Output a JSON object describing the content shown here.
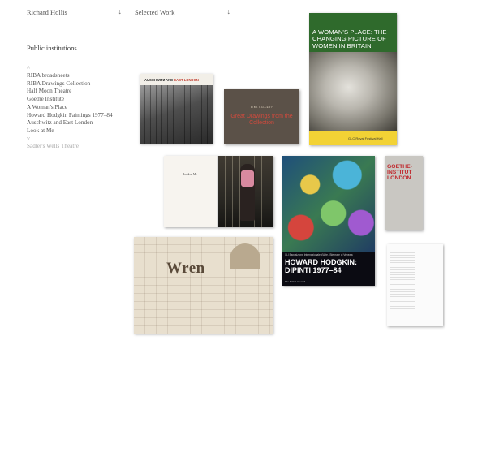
{
  "header": {
    "author_select": {
      "label": "Richard Hollis",
      "arrow": "↓"
    },
    "section_select": {
      "label": "Selected Work",
      "arrow": "↓"
    }
  },
  "category": {
    "title": "Public institutions",
    "up_arrow": "˄",
    "down_arrow": "˅",
    "items": [
      "RIBA broadsheets",
      "RIBA Drawings Collection",
      "Half Moon Theatre",
      "Goethe Institute",
      "A Woman's Place",
      "Howard Hodgkin Paintings 1977–84",
      "Auschwitz and East London",
      "Look at Me"
    ],
    "next_item": "Sadler's Wells Theatre"
  },
  "thumbnails": {
    "auschwitz": {
      "title_a": "AUSCHWITZ AND ",
      "title_b": "EAST LONDON"
    },
    "drawings": {
      "small": "RIBA GALLERY",
      "title": "Great Drawings from the Collection"
    },
    "woman": {
      "title": "A WOMAN'S PLACE: THE CHANGING PICTURE OF WOMEN IN BRITAIN",
      "venue": "GLC Royal Festival Hall"
    },
    "lookatme": {
      "title": "Look at Me"
    },
    "hodgkin": {
      "small": "XLI Esposizione Internazionale d'Arte / Biennale di Venezia",
      "title": "HOWARD HODGKIN: DIPINTI 1977–84",
      "credit": "The British Council"
    },
    "goethe": {
      "title": "GOETHE-INSTITUT LONDON"
    },
    "wren": {
      "title": "Wren"
    }
  },
  "colors": {
    "woman_green": "#2f6a2c",
    "woman_yellow": "#f2d235",
    "goethe_red": "#c0282d",
    "drawings_red": "#d14a3d"
  }
}
